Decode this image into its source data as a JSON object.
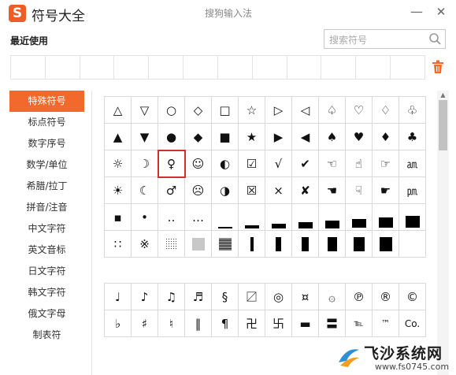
{
  "app": {
    "logo": "S",
    "title": "符号大全",
    "window_title": "搜狗输入法",
    "minimize": "—",
    "close": "✕"
  },
  "recent": {
    "label": "最近使用",
    "cells": 12
  },
  "search": {
    "placeholder": "搜索符号"
  },
  "sidebar": {
    "items": [
      {
        "label": "特殊符号",
        "active": true
      },
      {
        "label": "标点符号",
        "active": false
      },
      {
        "label": "数字序号",
        "active": false
      },
      {
        "label": "数学/单位",
        "active": false
      },
      {
        "label": "希腊/拉丁",
        "active": false
      },
      {
        "label": "拼音/注音",
        "active": false
      },
      {
        "label": "中文字符",
        "active": false
      },
      {
        "label": "英文音标",
        "active": false
      },
      {
        "label": "日文字符",
        "active": false
      },
      {
        "label": "韩文字符",
        "active": false
      },
      {
        "label": "俄文字母",
        "active": false
      },
      {
        "label": "制表符",
        "active": false
      }
    ]
  },
  "grid1": [
    [
      "△",
      "▽",
      "○",
      "◇",
      "□",
      "☆",
      "▷",
      "◁",
      "♤",
      "♡",
      "♢",
      "♧"
    ],
    [
      "▲",
      "▼",
      "●",
      "◆",
      "■",
      "★",
      "▶",
      "◀",
      "♠",
      "♥",
      "♦",
      "♣"
    ],
    [
      "☼",
      "☽",
      "♀",
      "☺",
      "◐",
      "☑",
      "√",
      "✔",
      "☜",
      "☝",
      "☞",
      "㏂"
    ],
    [
      "☀",
      "☾",
      "♂",
      "☹",
      "◑",
      "☒",
      "×",
      "✘",
      "☚",
      "☟",
      "☛",
      "㏘"
    ],
    [
      "▪",
      "•",
      "‥",
      "…",
      "bar1",
      "bar2",
      "bar3",
      "bar4",
      "bar5",
      "bar6",
      "bar7",
      "bar8"
    ],
    [
      "∷",
      "※",
      "shade1",
      "shade2",
      "shade3",
      "vbar1",
      "vbar2",
      "vbar3",
      "vbar4",
      "vbar5",
      "vbar6",
      ""
    ]
  ],
  "grid1_selected": "♀",
  "grid2": [
    [
      "♩",
      "♪",
      "♫",
      "♬",
      "§",
      "〼",
      "◎",
      "¤",
      "۞",
      "℗",
      "®",
      "©"
    ],
    [
      "♭",
      "♯",
      "♮",
      "‖",
      "¶",
      "卍",
      "卐",
      "▬",
      "〓",
      "℡",
      "™",
      "Co."
    ]
  ],
  "watermark": {
    "text": "飞沙系统网",
    "url": "www.fs0745.com"
  }
}
